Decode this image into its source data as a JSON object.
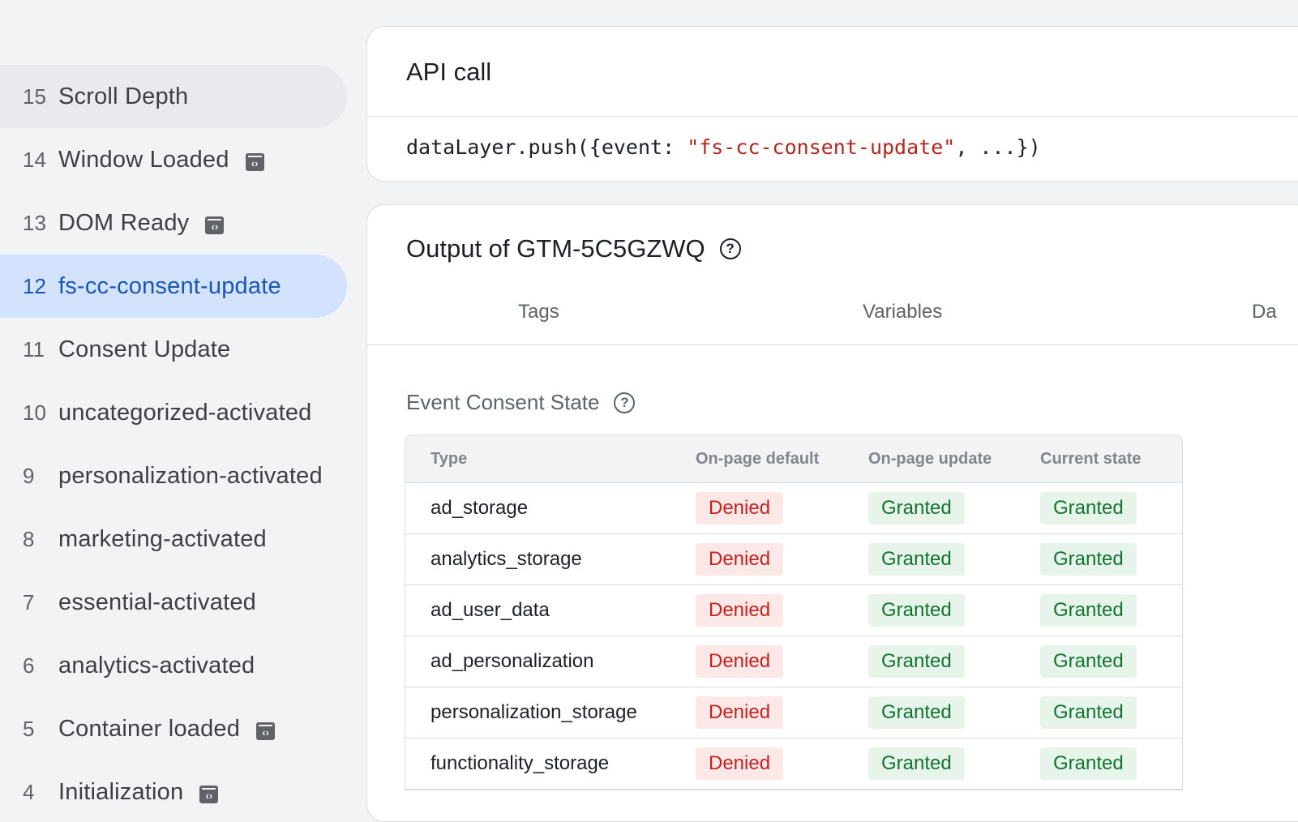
{
  "sidebar": {
    "items": [
      {
        "num": "15",
        "label": "Scroll Depth"
      },
      {
        "num": "14",
        "label": "Window Loaded"
      },
      {
        "num": "13",
        "label": "DOM Ready"
      },
      {
        "num": "12",
        "label": "fs-cc-consent-update"
      },
      {
        "num": "11",
        "label": "Consent Update"
      },
      {
        "num": "10",
        "label": "uncategorized-activated"
      },
      {
        "num": "9",
        "label": "personalization-activated"
      },
      {
        "num": "8",
        "label": "marketing-activated"
      },
      {
        "num": "7",
        "label": "essential-activated"
      },
      {
        "num": "6",
        "label": "analytics-activated"
      },
      {
        "num": "5",
        "label": "Container loaded"
      },
      {
        "num": "4",
        "label": "Initialization"
      }
    ]
  },
  "api_call": {
    "title": "API call",
    "code_prefix": "dataLayer.push({event: ",
    "code_string": "\"fs-cc-consent-update\"",
    "code_suffix": ", ...})"
  },
  "output": {
    "title": "Output of GTM-5C5GZWQ",
    "tabs": [
      "Tags",
      "Variables",
      "Da"
    ],
    "section_title": "Event Consent State",
    "table": {
      "headers": [
        "Type",
        "On-page default",
        "On-page update",
        "Current state"
      ],
      "rows": [
        {
          "type": "ad_storage",
          "default": "Denied",
          "update": "Granted",
          "current": "Granted"
        },
        {
          "type": "analytics_storage",
          "default": "Denied",
          "update": "Granted",
          "current": "Granted"
        },
        {
          "type": "ad_user_data",
          "default": "Denied",
          "update": "Granted",
          "current": "Granted"
        },
        {
          "type": "ad_personalization",
          "default": "Denied",
          "update": "Granted",
          "current": "Granted"
        },
        {
          "type": "personalization_storage",
          "default": "Denied",
          "update": "Granted",
          "current": "Granted"
        },
        {
          "type": "functionality_storage",
          "default": "Denied",
          "update": "Granted",
          "current": "Granted"
        }
      ]
    }
  },
  "colors": {
    "selected_bg": "#d3e3fd",
    "selected_text": "#1a56b8",
    "denied_bg": "#fce8e6",
    "denied_text": "#c5221f",
    "granted_bg": "#e6f4ea",
    "granted_text": "#137333"
  }
}
